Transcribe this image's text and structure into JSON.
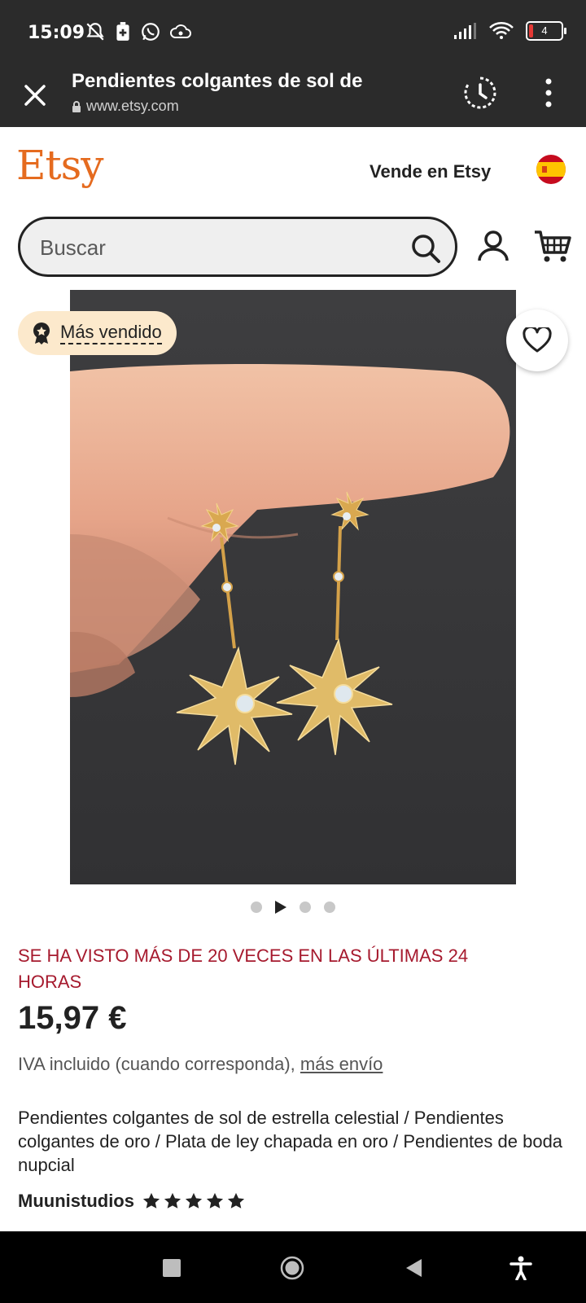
{
  "status_bar": {
    "time": "15:09",
    "battery_level": "4",
    "battery_color": "#e53935"
  },
  "browser": {
    "page_title": "Pendientes colgantes de sol de",
    "url": "www.etsy.com",
    "icons": [
      "close-icon",
      "history-icon",
      "more-vert-icon"
    ]
  },
  "header": {
    "logo": "Etsy",
    "sell_link": "Vende en Etsy",
    "language_flag": "spain-flag-icon",
    "brand_color": "#e56b1f"
  },
  "search": {
    "placeholder": "Buscar"
  },
  "gallery": {
    "badge": "Más vendido",
    "image_count": 4,
    "current_index": 2
  },
  "product": {
    "views_notice": "SE HA VISTO MÁS DE 20 VECES EN LAS ÚLTIMAS 24 HORAS",
    "price": "15,97 €",
    "tax_text": "IVA incluido (cuando corresponda),",
    "shipping_link": "más envío",
    "title": "Pendientes colgantes de sol de estrella celestial / Pendientes colgantes de oro / Plata de ley chapada en oro / Pendientes de boda nupcial",
    "shop_name": "Muunistudios",
    "rating_stars": 5,
    "notice_color": "#a61a2e"
  }
}
